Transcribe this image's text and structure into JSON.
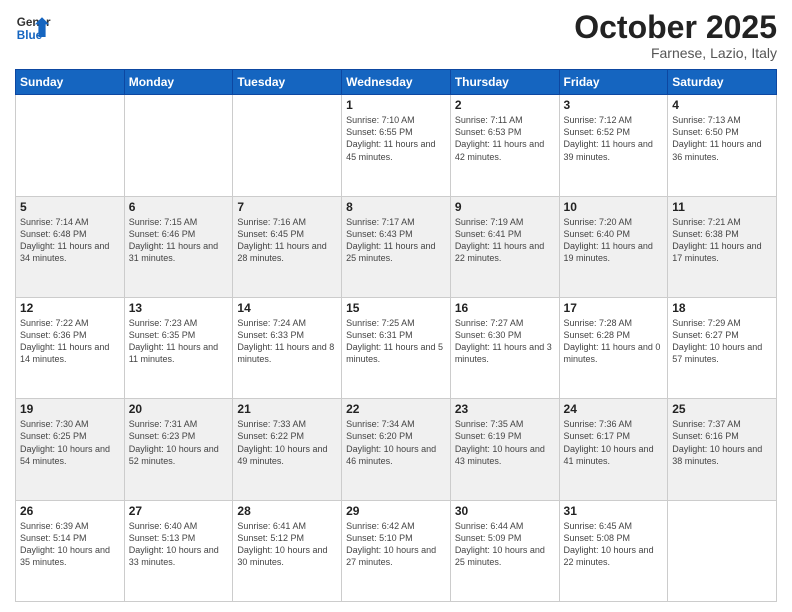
{
  "logo": {
    "general": "General",
    "blue": "Blue"
  },
  "header": {
    "month": "October 2025",
    "location": "Farnese, Lazio, Italy"
  },
  "weekdays": [
    "Sunday",
    "Monday",
    "Tuesday",
    "Wednesday",
    "Thursday",
    "Friday",
    "Saturday"
  ],
  "weeks": [
    [
      {
        "day": "",
        "info": ""
      },
      {
        "day": "",
        "info": ""
      },
      {
        "day": "",
        "info": ""
      },
      {
        "day": "1",
        "info": "Sunrise: 7:10 AM\nSunset: 6:55 PM\nDaylight: 11 hours and 45 minutes."
      },
      {
        "day": "2",
        "info": "Sunrise: 7:11 AM\nSunset: 6:53 PM\nDaylight: 11 hours and 42 minutes."
      },
      {
        "day": "3",
        "info": "Sunrise: 7:12 AM\nSunset: 6:52 PM\nDaylight: 11 hours and 39 minutes."
      },
      {
        "day": "4",
        "info": "Sunrise: 7:13 AM\nSunset: 6:50 PM\nDaylight: 11 hours and 36 minutes."
      }
    ],
    [
      {
        "day": "5",
        "info": "Sunrise: 7:14 AM\nSunset: 6:48 PM\nDaylight: 11 hours and 34 minutes."
      },
      {
        "day": "6",
        "info": "Sunrise: 7:15 AM\nSunset: 6:46 PM\nDaylight: 11 hours and 31 minutes."
      },
      {
        "day": "7",
        "info": "Sunrise: 7:16 AM\nSunset: 6:45 PM\nDaylight: 11 hours and 28 minutes."
      },
      {
        "day": "8",
        "info": "Sunrise: 7:17 AM\nSunset: 6:43 PM\nDaylight: 11 hours and 25 minutes."
      },
      {
        "day": "9",
        "info": "Sunrise: 7:19 AM\nSunset: 6:41 PM\nDaylight: 11 hours and 22 minutes."
      },
      {
        "day": "10",
        "info": "Sunrise: 7:20 AM\nSunset: 6:40 PM\nDaylight: 11 hours and 19 minutes."
      },
      {
        "day": "11",
        "info": "Sunrise: 7:21 AM\nSunset: 6:38 PM\nDaylight: 11 hours and 17 minutes."
      }
    ],
    [
      {
        "day": "12",
        "info": "Sunrise: 7:22 AM\nSunset: 6:36 PM\nDaylight: 11 hours and 14 minutes."
      },
      {
        "day": "13",
        "info": "Sunrise: 7:23 AM\nSunset: 6:35 PM\nDaylight: 11 hours and 11 minutes."
      },
      {
        "day": "14",
        "info": "Sunrise: 7:24 AM\nSunset: 6:33 PM\nDaylight: 11 hours and 8 minutes."
      },
      {
        "day": "15",
        "info": "Sunrise: 7:25 AM\nSunset: 6:31 PM\nDaylight: 11 hours and 5 minutes."
      },
      {
        "day": "16",
        "info": "Sunrise: 7:27 AM\nSunset: 6:30 PM\nDaylight: 11 hours and 3 minutes."
      },
      {
        "day": "17",
        "info": "Sunrise: 7:28 AM\nSunset: 6:28 PM\nDaylight: 11 hours and 0 minutes."
      },
      {
        "day": "18",
        "info": "Sunrise: 7:29 AM\nSunset: 6:27 PM\nDaylight: 10 hours and 57 minutes."
      }
    ],
    [
      {
        "day": "19",
        "info": "Sunrise: 7:30 AM\nSunset: 6:25 PM\nDaylight: 10 hours and 54 minutes."
      },
      {
        "day": "20",
        "info": "Sunrise: 7:31 AM\nSunset: 6:23 PM\nDaylight: 10 hours and 52 minutes."
      },
      {
        "day": "21",
        "info": "Sunrise: 7:33 AM\nSunset: 6:22 PM\nDaylight: 10 hours and 49 minutes."
      },
      {
        "day": "22",
        "info": "Sunrise: 7:34 AM\nSunset: 6:20 PM\nDaylight: 10 hours and 46 minutes."
      },
      {
        "day": "23",
        "info": "Sunrise: 7:35 AM\nSunset: 6:19 PM\nDaylight: 10 hours and 43 minutes."
      },
      {
        "day": "24",
        "info": "Sunrise: 7:36 AM\nSunset: 6:17 PM\nDaylight: 10 hours and 41 minutes."
      },
      {
        "day": "25",
        "info": "Sunrise: 7:37 AM\nSunset: 6:16 PM\nDaylight: 10 hours and 38 minutes."
      }
    ],
    [
      {
        "day": "26",
        "info": "Sunrise: 6:39 AM\nSunset: 5:14 PM\nDaylight: 10 hours and 35 minutes."
      },
      {
        "day": "27",
        "info": "Sunrise: 6:40 AM\nSunset: 5:13 PM\nDaylight: 10 hours and 33 minutes."
      },
      {
        "day": "28",
        "info": "Sunrise: 6:41 AM\nSunset: 5:12 PM\nDaylight: 10 hours and 30 minutes."
      },
      {
        "day": "29",
        "info": "Sunrise: 6:42 AM\nSunset: 5:10 PM\nDaylight: 10 hours and 27 minutes."
      },
      {
        "day": "30",
        "info": "Sunrise: 6:44 AM\nSunset: 5:09 PM\nDaylight: 10 hours and 25 minutes."
      },
      {
        "day": "31",
        "info": "Sunrise: 6:45 AM\nSunset: 5:08 PM\nDaylight: 10 hours and 22 minutes."
      },
      {
        "day": "",
        "info": ""
      }
    ]
  ]
}
